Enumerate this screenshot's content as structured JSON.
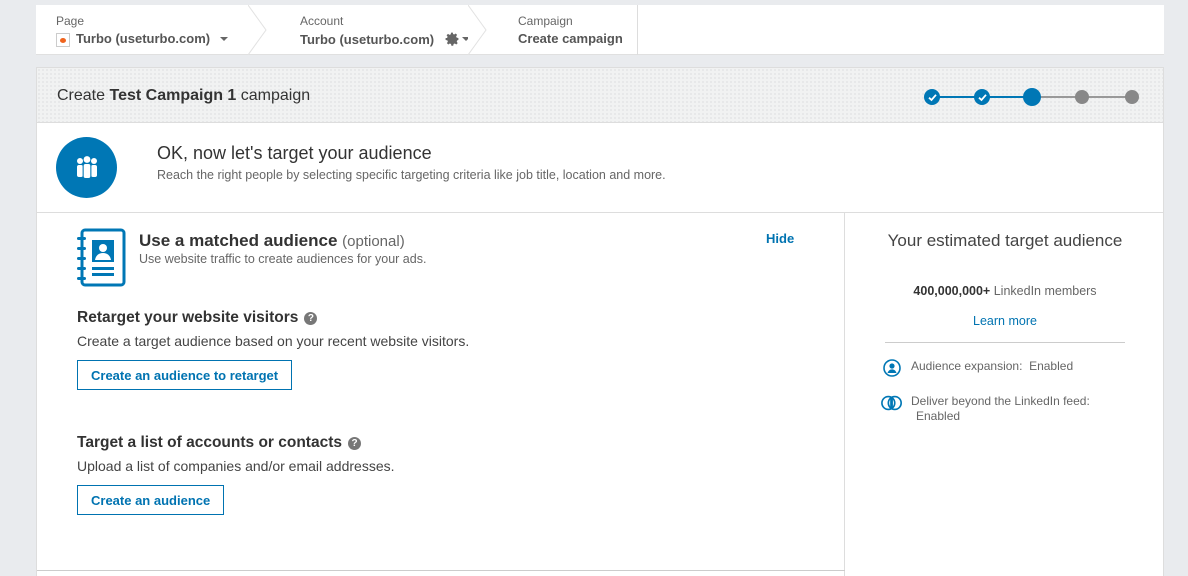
{
  "breadcrumb": {
    "page": {
      "label": "Page",
      "value": "Turbo (useturbo.com)"
    },
    "account": {
      "label": "Account",
      "value": "Turbo (useturbo.com)"
    },
    "campaign": {
      "label": "Campaign",
      "value": "Create campaign"
    }
  },
  "header": {
    "prefix": "Create",
    "campaign_name": "Test Campaign 1",
    "suffix": "campaign"
  },
  "progress": {
    "total_steps": 5,
    "current_step": 3,
    "completed_steps": 2
  },
  "intro": {
    "title": "OK, now let's target your audience",
    "subtitle": "Reach the right people by selecting specific targeting criteria like job title, location and more."
  },
  "matched": {
    "title": "Use a matched audience",
    "optional": "(optional)",
    "subtitle": "Use website traffic to create audiences for your ads.",
    "hide_label": "Hide"
  },
  "retarget": {
    "title": "Retarget your website visitors",
    "subtitle": "Create a target audience based on your recent website visitors.",
    "button": "Create an audience to retarget"
  },
  "accounts": {
    "title": "Target a list of accounts or contacts",
    "subtitle": "Upload a list of companies and/or email addresses.",
    "button": "Create an audience"
  },
  "estimate": {
    "title": "Your estimated target audience",
    "count": "400,000,000+",
    "count_suffix": "LinkedIn members",
    "learn_more": "Learn more",
    "expansion": "Audience expansion:  Enabled",
    "deliver_line1": "Deliver beyond the LinkedIn feed:",
    "deliver_line2": "Enabled"
  },
  "colors": {
    "accent": "#0077b5",
    "link": "#0073b1",
    "inactive_step": "#888888"
  }
}
